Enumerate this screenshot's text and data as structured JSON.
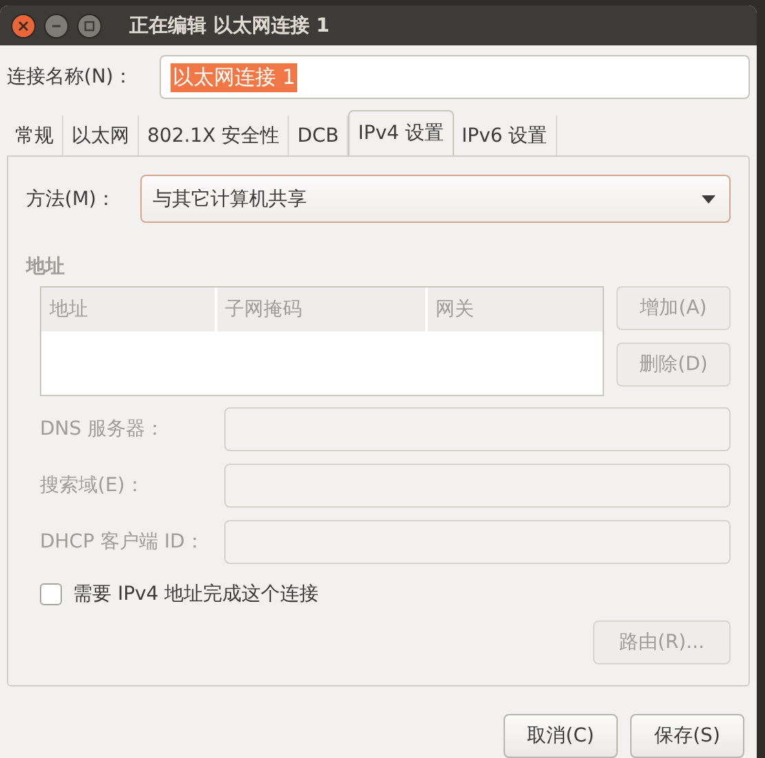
{
  "window": {
    "title": "正在编辑 以太网连接 1"
  },
  "connection_name": {
    "label": "连接名称(N)：",
    "value": "以太网连接 1",
    "text_selected": true
  },
  "tabs": [
    {
      "label": "常规",
      "selected": false
    },
    {
      "label": "以太网",
      "selected": false
    },
    {
      "label": "802.1X 安全性",
      "selected": false
    },
    {
      "label": "DCB",
      "selected": false
    },
    {
      "label": "IPv4 设置",
      "selected": true
    },
    {
      "label": "IPv6 设置",
      "selected": false
    }
  ],
  "method": {
    "label": "方法(M)：",
    "value": "与其它计算机共享"
  },
  "addresses": {
    "heading": "地址",
    "columns": [
      "地址",
      "子网掩码",
      "网关"
    ],
    "buttons": [
      {
        "label": "增加(A)",
        "disabled": true
      },
      {
        "label": "删除(D)",
        "disabled": true
      }
    ]
  },
  "fields": [
    {
      "label": "DNS 服务器：",
      "disabled": true
    },
    {
      "label": "搜索域(E)：",
      "disabled": true
    },
    {
      "label": "DHCP 客户端 ID：",
      "disabled": true
    }
  ],
  "require_ipv4": {
    "label": "需要 IPv4 地址完成这个连接",
    "checked": false
  },
  "routes_button": {
    "label": "路由(R)...",
    "disabled": true
  },
  "buttons": [
    {
      "label": "取消(C)"
    },
    {
      "label": "保存(S)"
    }
  ]
}
